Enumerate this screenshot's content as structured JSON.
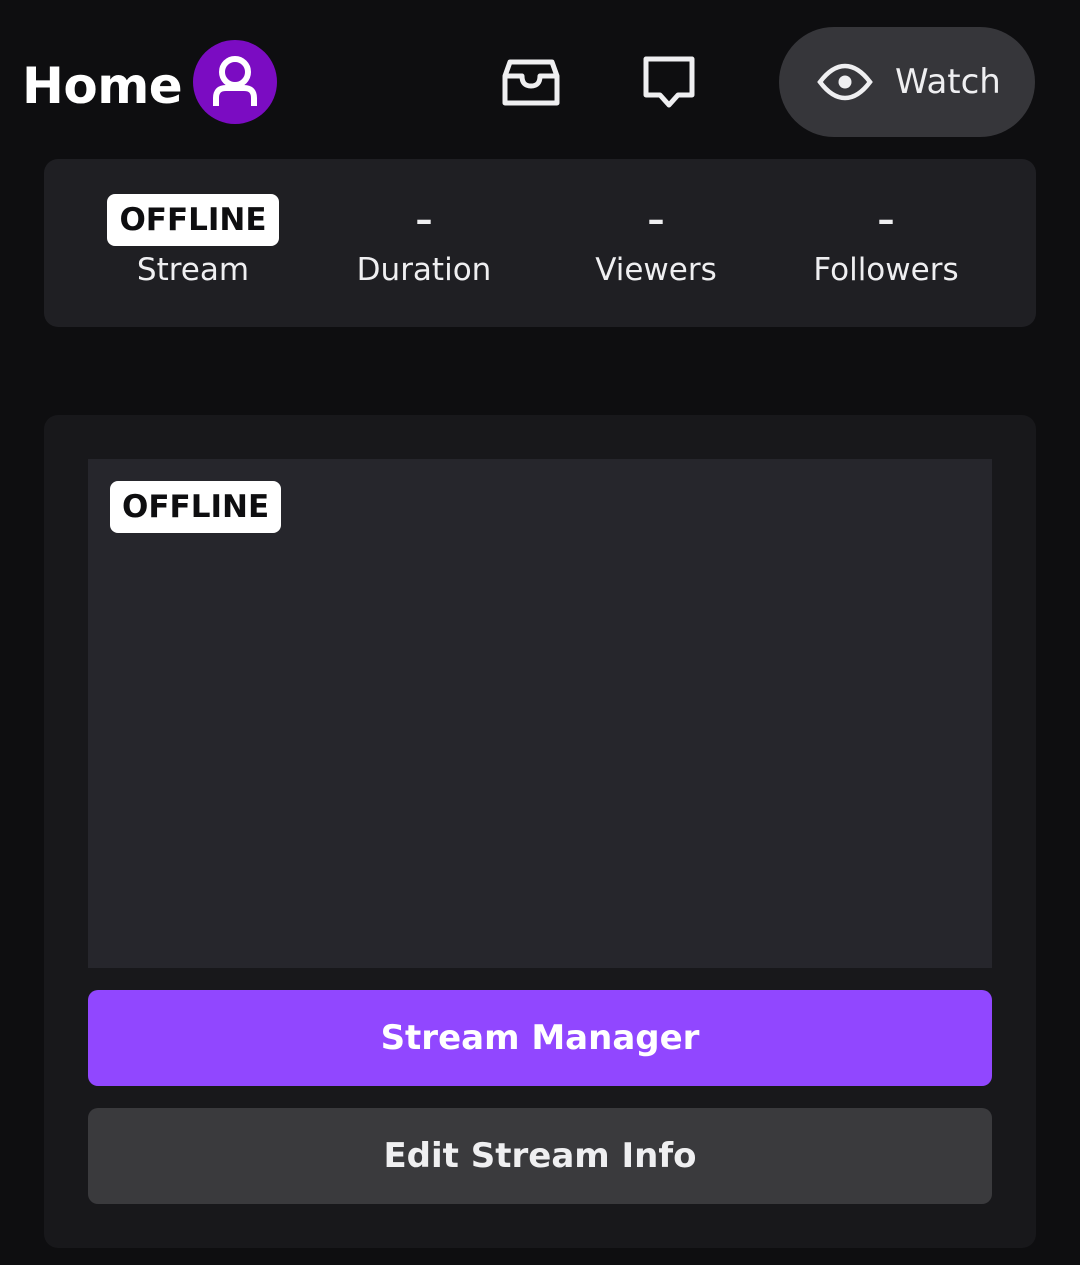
{
  "header": {
    "title": "Home",
    "avatar_icon": "user-icon",
    "avatar_color": "#7b0cc2",
    "inbox_icon": "inbox-icon",
    "whispers_icon": "chat-bubble-icon",
    "watch_label": "Watch",
    "watch_icon": "eye-icon"
  },
  "stats": {
    "stream": {
      "value": "OFFLINE",
      "label": "Stream"
    },
    "duration": {
      "value": "–",
      "label": "Duration"
    },
    "viewers": {
      "value": "–",
      "label": "Viewers"
    },
    "followers": {
      "value": "–",
      "label": "Followers"
    }
  },
  "preview": {
    "status_badge": "OFFLINE"
  },
  "actions": {
    "stream_manager_label": "Stream Manager",
    "edit_stream_info_label": "Edit Stream Info"
  },
  "colors": {
    "accent": "#9147ff",
    "background": "#0e0e10",
    "card": "#1f1f23"
  }
}
